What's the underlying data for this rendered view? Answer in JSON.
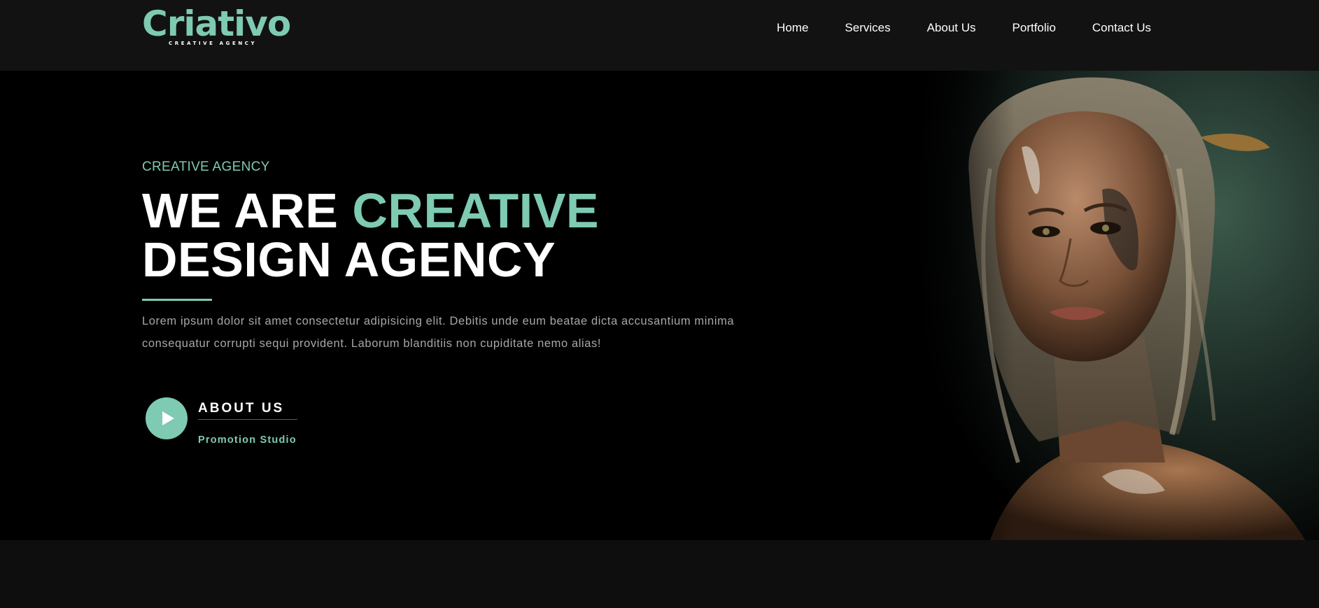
{
  "header": {
    "logo_text": "Criativo",
    "logo_tagline": "CREATIVE AGENCY",
    "nav": [
      {
        "label": "Home"
      },
      {
        "label": "Services"
      },
      {
        "label": "About Us"
      },
      {
        "label": "Portfolio"
      },
      {
        "label": "Contact Us"
      }
    ]
  },
  "hero": {
    "eyebrow": "CREATIVE AGENCY",
    "headline_part1": "WE ARE ",
    "headline_accent": "CREATIVE",
    "headline_part2": " DESIGN AGENCY",
    "description": "Lorem ipsum dolor sit amet consectetur adipisicing elit. Debitis unde eum beatae dicta accusantium minima consequatur corrupti sequi provident. Laborum blanditiis non cupiditate nemo alias!",
    "cta_title": "ABOUT US",
    "cta_subtitle": "Promotion Studio",
    "image_icon": "portrait-illustration"
  },
  "colors": {
    "accent": "#7ecab2",
    "header_bg": "#121212",
    "hero_bg": "#000000",
    "body_text": "#a7a7a7"
  }
}
